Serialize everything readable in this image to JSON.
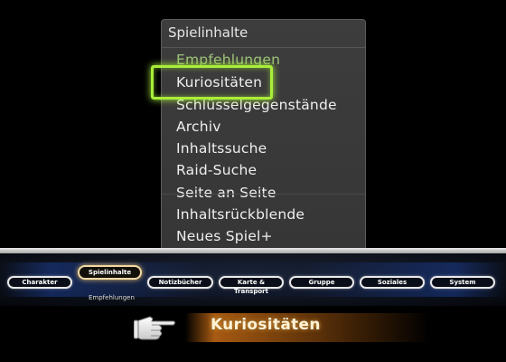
{
  "menu": {
    "title": "Spielinhalte",
    "items": [
      {
        "label": "Empfehlungen"
      },
      {
        "label": "Kuriositäten"
      },
      {
        "label": "Schlüsselgegenstände"
      },
      {
        "label": "Archiv"
      },
      {
        "label": "Inhaltssuche"
      },
      {
        "label": "Raid-Suche"
      },
      {
        "label": "Seite an Seite"
      },
      {
        "label": "Inhaltsrückblende"
      },
      {
        "label": "Neues Spiel+"
      }
    ],
    "selected_index": 1,
    "highlight_color": "#a8ee3a"
  },
  "navbar": {
    "tabs": [
      {
        "label": "Charakter"
      },
      {
        "label": "Spielinhalte"
      },
      {
        "label": "Notizbücher"
      },
      {
        "label": "Karte & Transport"
      },
      {
        "label": "Gruppe"
      },
      {
        "label": "Soziales"
      },
      {
        "label": "System"
      }
    ],
    "active_tab_index": 1,
    "active_sub_label": "Empfehlungen"
  },
  "hint": {
    "text": "Kuriositäten",
    "pointer_icon": "pointing-hand-icon"
  }
}
